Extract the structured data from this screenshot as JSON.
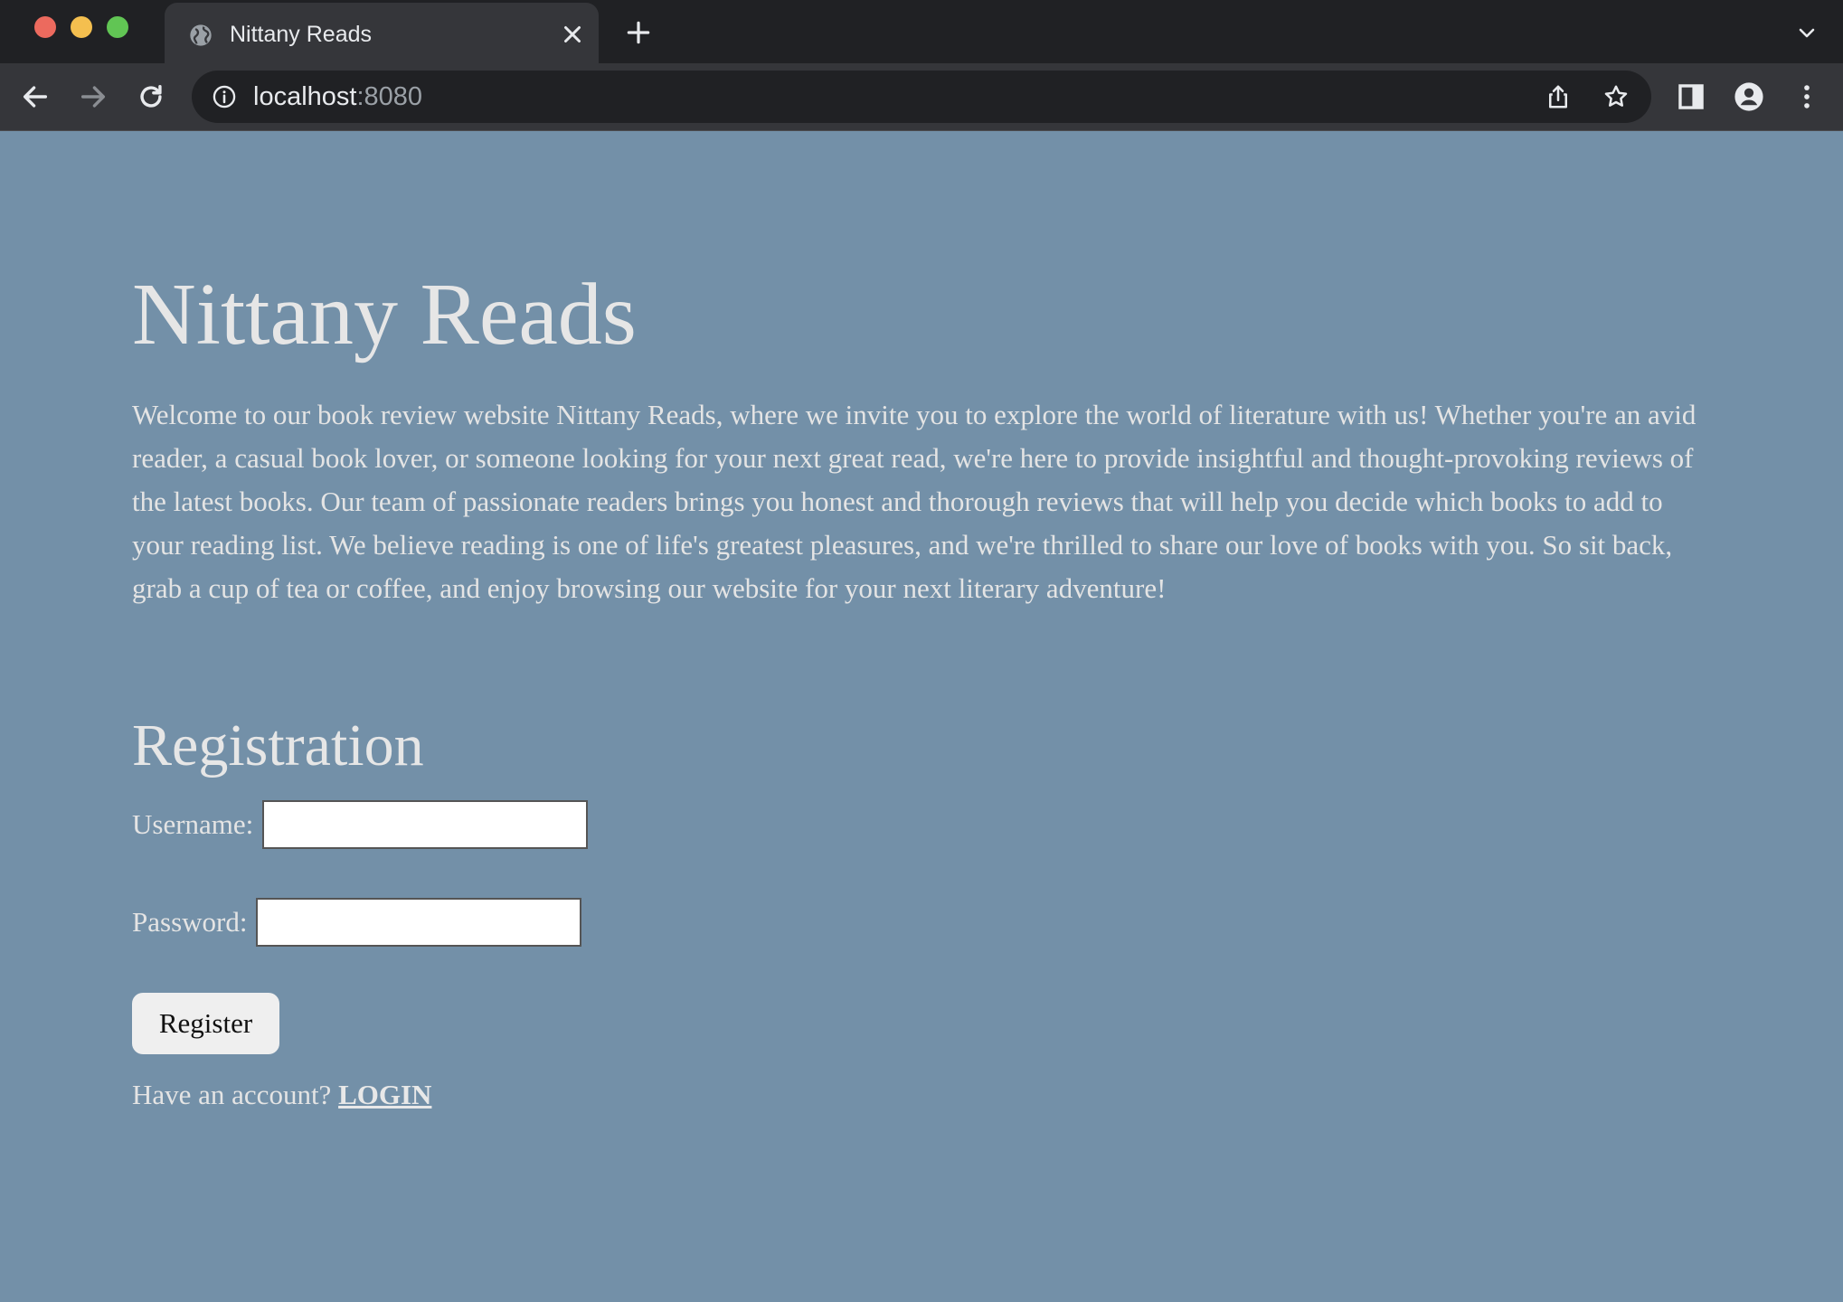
{
  "browser": {
    "tab": {
      "title": "Nittany Reads",
      "favicon": "globe-icon",
      "close": "close-icon"
    },
    "new_tab": "plus-icon",
    "tab_list": "chevron-down-icon",
    "address": {
      "host": "localhost",
      "port": ":8080",
      "security": "info-icon"
    },
    "toolbar_icons": [
      "back-icon",
      "forward-icon",
      "reload-icon",
      "share-icon",
      "star-icon",
      "side-panel-icon",
      "profile-icon",
      "menu-icon"
    ]
  },
  "page": {
    "background": "#7390a8",
    "title": "Nittany Reads",
    "intro": "Welcome to our book review website Nittany Reads, where we invite you to explore the world of literature with us! Whether you're an avid reader, a casual book lover, or someone looking for your next great read, we're here to provide insightful and thought-provoking reviews of the latest books. Our team of passionate readers brings you honest and thorough reviews that will help you decide which books to add to your reading list. We believe reading is one of life's greatest pleasures, and we're thrilled to share our love of books with you. So sit back, grab a cup of tea or coffee, and enjoy browsing our website for your next literary adventure!",
    "registration": {
      "heading": "Registration",
      "username_label": "Username:",
      "username_value": "",
      "password_label": "Password:",
      "password_value": "",
      "submit_label": "Register",
      "login_prompt": "Have an account?",
      "login_link": "LOGIN"
    }
  }
}
